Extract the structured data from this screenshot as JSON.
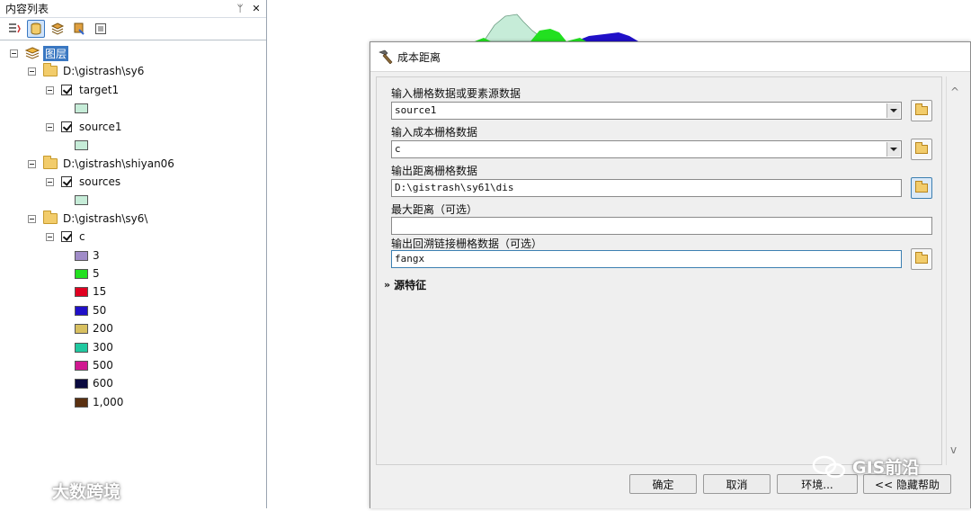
{
  "toc": {
    "title": "内容列表",
    "pin": "ᛘ",
    "close": "✕",
    "root_label": "图层",
    "groups": [
      {
        "path": "D:\\gistrash\\sy6",
        "layers": [
          {
            "name": "target1",
            "swatch": "#c6ecd8"
          }
        ]
      },
      {
        "layers": [
          {
            "name": "source1",
            "swatch": "#c6ecd8"
          }
        ]
      },
      {
        "path": "D:\\gistrash\\shiyan06",
        "layers": [
          {
            "name": "sources",
            "swatch": "#c6ecd8"
          }
        ]
      },
      {
        "path": "D:\\gistrash\\sy6\\",
        "layers": [
          {
            "name": "c"
          }
        ]
      }
    ],
    "legend": [
      {
        "value": "3",
        "color": "#a08cc8"
      },
      {
        "value": "5",
        "color": "#22e020"
      },
      {
        "value": "15",
        "color": "#e00020"
      },
      {
        "value": "50",
        "color": "#2010c8"
      },
      {
        "value": "200",
        "color": "#d8c060"
      },
      {
        "value": "300",
        "color": "#20c8a0"
      },
      {
        "value": "500",
        "color": "#d01890"
      },
      {
        "value": "600",
        "color": "#0a0a40"
      },
      {
        "value": "1,000",
        "color": "#5a3010"
      }
    ]
  },
  "dialog": {
    "title": "成本距离",
    "fields": {
      "input_source_label": "输入栅格数据或要素源数据",
      "input_source_value": "source1",
      "cost_raster_label": "输入成本栅格数据",
      "cost_raster_value": "c",
      "output_distance_label": "输出距离栅格数据",
      "output_distance_value": "D:\\gistrash\\sy61\\dis",
      "max_distance_label": "最大距离（可选）",
      "max_distance_value": "",
      "backlink_label": "输出回溯链接栅格数据（可选）",
      "backlink_value": "fangx"
    },
    "environment_label": "源特征",
    "buttons": {
      "ok": "确定",
      "cancel": "取消",
      "environments": "环境...",
      "hide_help": "<< 隐藏帮助"
    }
  },
  "watermarks": {
    "left": "大数跨境",
    "right": "GIS前沿"
  },
  "colors": {
    "accent": "#3a78c2",
    "map_green": "#22e020",
    "map_blue": "#2010c8",
    "map_mint": "#c6ecd8"
  }
}
